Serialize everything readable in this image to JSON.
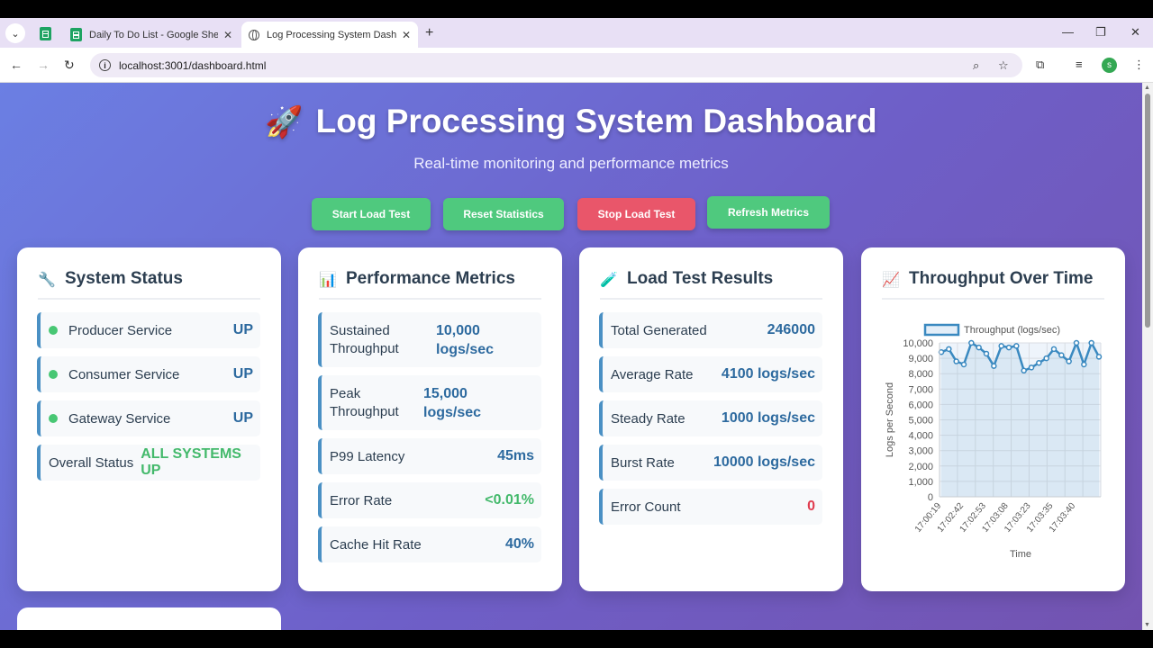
{
  "browser": {
    "tabs": [
      {
        "label": "Daily To Do List - Google Sheets",
        "active": false
      },
      {
        "label": "Log Processing System Dashboard",
        "active": true
      }
    ],
    "url": "localhost:3001/dashboard.html",
    "profile_initial": "s",
    "icons": [
      "tab-search-icon",
      "sheets-icon",
      "globe-icon",
      "new-tab-icon",
      "minimize-icon",
      "restore-icon",
      "close-icon",
      "back-icon",
      "forward-icon",
      "reload-icon",
      "info-icon",
      "zoom-icon",
      "star-icon",
      "extensions-icon",
      "media-icon",
      "menu-icon"
    ]
  },
  "header": {
    "icon": "rocket-icon",
    "title": "Log Processing System Dashboard",
    "subtitle": "Real-time monitoring and performance metrics"
  },
  "buttons": {
    "start": "Start Load Test",
    "reset": "Reset Statistics",
    "stop": "Stop Load Test",
    "refresh": "Refresh Metrics"
  },
  "system_status": {
    "title": "System Status",
    "icon": "wrench-icon",
    "services": [
      {
        "name": "Producer Service",
        "status": "UP"
      },
      {
        "name": "Consumer Service",
        "status": "UP"
      },
      {
        "name": "Gateway Service",
        "status": "UP"
      }
    ],
    "overall_label": "Overall Status",
    "overall_value": "ALL SYSTEMS UP"
  },
  "performance": {
    "title": "Performance Metrics",
    "icon": "bar-chart-icon",
    "metrics": [
      {
        "label": "Sustained Throughput",
        "value": "10,000 logs/sec"
      },
      {
        "label": "Peak Throughput",
        "value": "15,000 logs/sec"
      },
      {
        "label": "P99 Latency",
        "value": "45ms"
      },
      {
        "label": "Error Rate",
        "value": "<0.01%"
      },
      {
        "label": "Cache Hit Rate",
        "value": "40%"
      }
    ]
  },
  "load_test": {
    "title": "Load Test Results",
    "icon": "test-tube-icon",
    "results": [
      {
        "label": "Total Generated",
        "value": "246000"
      },
      {
        "label": "Average Rate",
        "value": "4100 logs/sec"
      },
      {
        "label": "Steady Rate",
        "value": "1000 logs/sec"
      },
      {
        "label": "Burst Rate",
        "value": "10000 logs/sec"
      },
      {
        "label": "Error Count",
        "value": "0"
      }
    ]
  },
  "throughput": {
    "title": "Throughput Over Time",
    "icon": "trend-chart-icon"
  },
  "colors": {
    "accent_blue": "#2d6a9f",
    "green": "#4fc97e",
    "red": "#e9566a",
    "line": "#4a90c4"
  },
  "chart_data": {
    "type": "line",
    "legend": "Throughput (logs/sec)",
    "legend_position": "top",
    "xlabel": "Time",
    "ylabel": "Logs per Second",
    "ylim": [
      0,
      10000
    ],
    "yticks": [
      "0",
      "1,000",
      "2,000",
      "3,000",
      "4,000",
      "5,000",
      "6,000",
      "7,000",
      "8,000",
      "9,000",
      "10,000"
    ],
    "xtick_labels": [
      "17:00:19",
      "17:02:42",
      "17:02:53",
      "17:03:08",
      "17:03:23",
      "17:03:35",
      "17:03:40"
    ],
    "grid": true,
    "series": [
      {
        "name": "Throughput (logs/sec)",
        "values": [
          9400,
          9600,
          8800,
          8600,
          10000,
          9700,
          9300,
          8500,
          9800,
          9700,
          9800,
          8200,
          8400,
          8700,
          9000,
          9600,
          9200,
          8800,
          10000,
          8600,
          10000,
          9100
        ]
      }
    ]
  }
}
